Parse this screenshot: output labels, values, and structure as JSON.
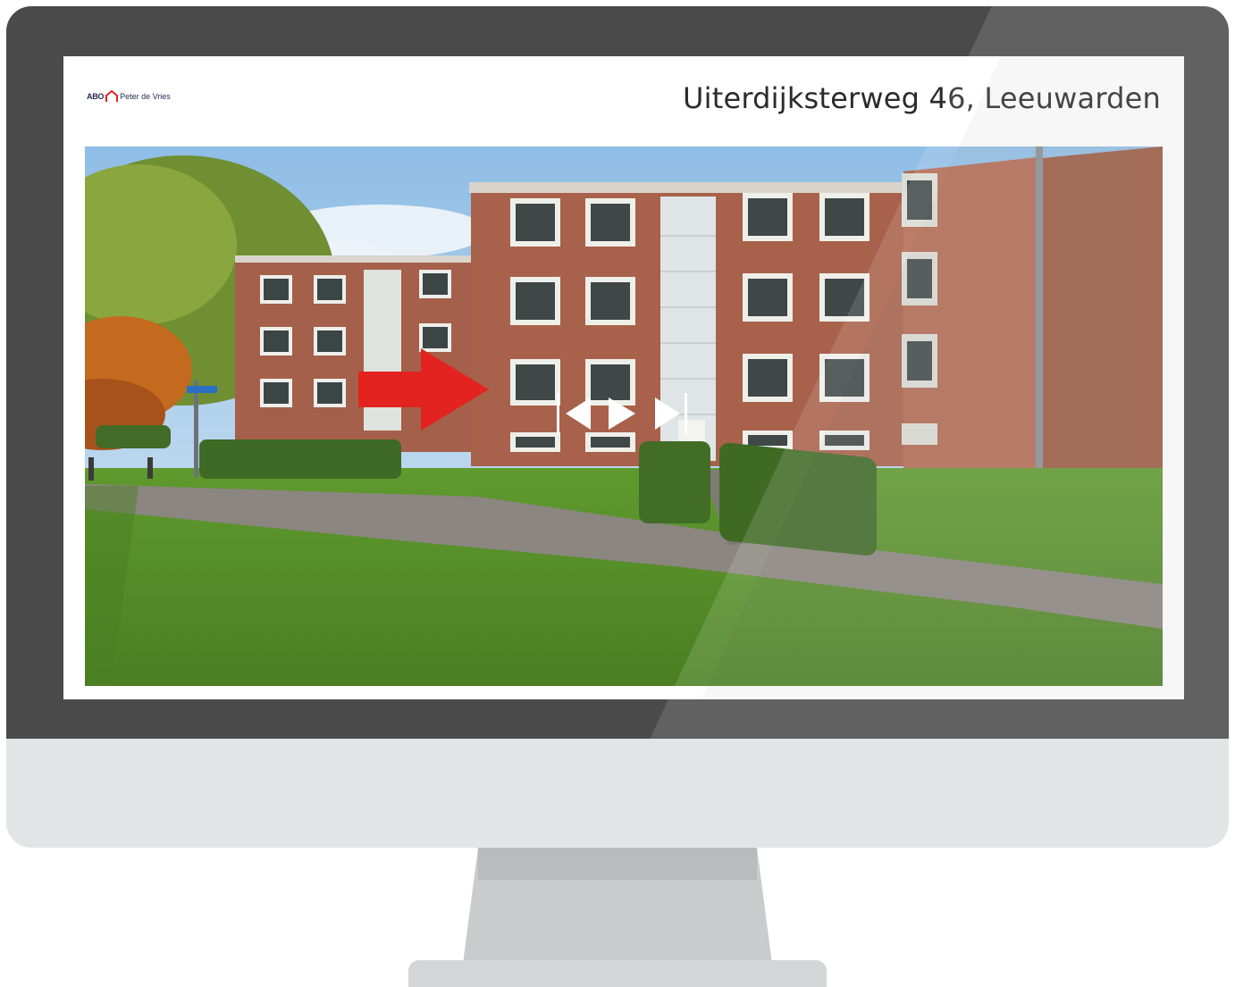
{
  "brand": {
    "abo": "ABO",
    "name": "Peter de Vries",
    "accent_color": "#e3231f"
  },
  "header": {
    "title": "Uiterdijksterweg 46, Leeuwarden"
  },
  "viewer": {
    "nav_arrow_icon": "arrow-right-icon",
    "controls": [
      {
        "icon": "skip-back-icon"
      },
      {
        "icon": "play-icon"
      },
      {
        "icon": "skip-forward-icon"
      }
    ]
  }
}
